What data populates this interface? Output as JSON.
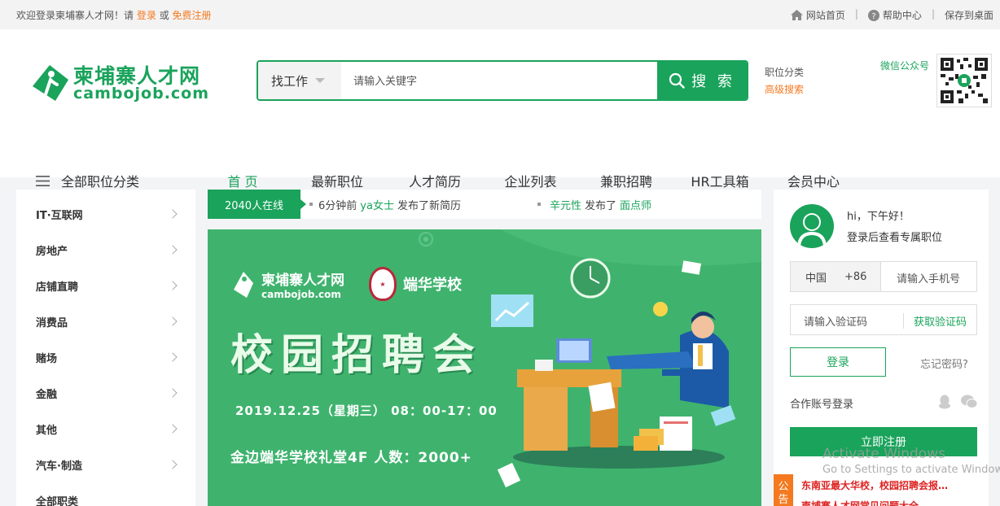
{
  "topbar": {
    "welcome_prefix": "欢迎登录柬埔寨人才网！请",
    "login": "登录",
    "or": "或",
    "register": "免费注册",
    "home": "网站首页",
    "help": "帮助中心",
    "save_desktop": "保存到桌面"
  },
  "header": {
    "logo_cn": "柬埔寨人才网",
    "logo_en": "cambojob.com",
    "search_category": "找工作",
    "search_placeholder": "请输入关键字",
    "search_button": "搜 索",
    "link_categories": "职位分类",
    "link_advanced": "高级搜索",
    "wechat_label": "微信公众号"
  },
  "nav": {
    "all_categories": "全部职位分类",
    "items": [
      {
        "label": "首 页"
      },
      {
        "label": "最新职位"
      },
      {
        "label": "人才简历"
      },
      {
        "label": "企业列表"
      },
      {
        "label": "兼职招聘"
      },
      {
        "label": "HR工具箱"
      },
      {
        "label": "会员中心"
      }
    ]
  },
  "sidebar": {
    "items": [
      {
        "label": "IT·互联网"
      },
      {
        "label": "房地产"
      },
      {
        "label": "店铺直聘"
      },
      {
        "label": "消费品"
      },
      {
        "label": "赌场"
      },
      {
        "label": "金融"
      },
      {
        "label": "其他"
      },
      {
        "label": "汽车·制造"
      },
      {
        "label": "全部职类"
      }
    ]
  },
  "ticker": {
    "online": "2040人在线",
    "m1_time": "6分钟前",
    "m1_user": "ya女士",
    "m1_action": "发布了新简历",
    "m2_user": "辛元性",
    "m2_action": "发布了",
    "m2_job": "面点师"
  },
  "banner": {
    "brand_cn": "柬埔寨人才网",
    "brand_en": "cambojob.com",
    "school": "端华学校",
    "title": "校园招聘会",
    "date": "2019.12.25（星期三） 08：00-17：00",
    "venue": "金边端华学校礼堂4F  人数：2000+"
  },
  "login": {
    "greeting": "hi，下午好！",
    "subtitle": "登录后查看专属职位",
    "country": "中国",
    "country_code": "+86",
    "phone_placeholder": "请输入手机号",
    "code_placeholder": "请输入验证码",
    "get_code": "获取验证码",
    "login_button": "登录",
    "forgot": "忘记密码?",
    "coop_login": "合作账号登录",
    "register_button": "立即注册"
  },
  "notice": {
    "tag": "公告",
    "item1": "东南亚最大华校，校园招聘会报…",
    "item2": "柬埔寨人才网常见问题大全"
  },
  "watermark": {
    "line1": "Activate Windows",
    "line2": "Go to Settings to activate Windows."
  },
  "colors": {
    "brand": "#1aa35b",
    "accent": "#f4791f"
  }
}
